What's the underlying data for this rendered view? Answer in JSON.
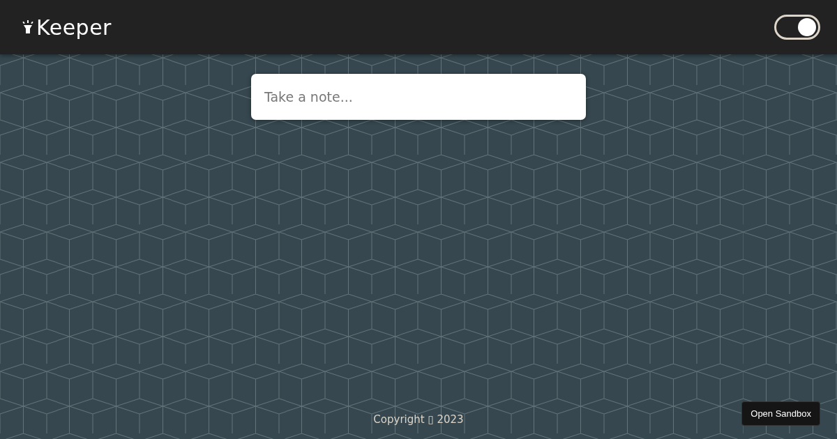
{
  "header": {
    "title": "Keeper",
    "theme_toggle": {
      "on": true
    }
  },
  "note_form": {
    "placeholder": "Take a note..."
  },
  "footer": {
    "text": "Copyright ▯ 2023"
  },
  "sandbox_button": {
    "label": "Open Sandbox"
  }
}
